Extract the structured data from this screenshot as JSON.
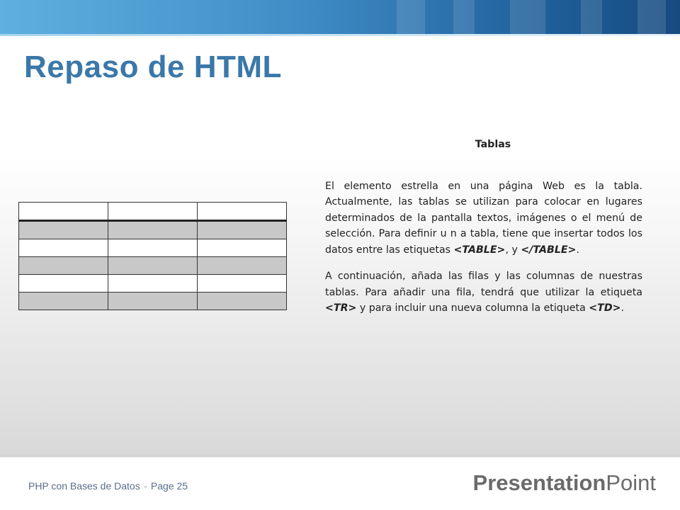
{
  "slide": {
    "title": "Repaso de HTML",
    "section_heading": "Tablas",
    "paragraph1": {
      "text_before": "El elemento estrella en una página Web es la tabla. Actualmente, las tablas se utilizan para colocar en lugares determinados de la pantalla textos, imágenes o el menú de selección. Para definir u n a tabla, tiene que insertar todos los datos entre las etiquetas ",
      "tag_open": "<TABLE>",
      "mid": ", y ",
      "tag_close": "</TABLE>",
      "end": "."
    },
    "paragraph2": {
      "text_before": "A continuación, añada las filas y las columnas de nuestras tablas. Para añadir una fila, tendrá que utilizar la etiqueta ",
      "tag_tr": "<TR>",
      "mid": " y para incluir una nueva columna la etiqueta ",
      "tag_td": "<TD>",
      "end": "."
    }
  },
  "footer": {
    "course": "PHP con Bases de Datos",
    "separator": "▫",
    "page_label": "Page 25",
    "brand_bold": "Presentation",
    "brand_regular": "Point"
  },
  "colors": {
    "title": "#3a78a9",
    "header_gradient_start": "#5fb0e0",
    "header_gradient_end": "#174b80",
    "table_shade": "#c8c8c8"
  }
}
